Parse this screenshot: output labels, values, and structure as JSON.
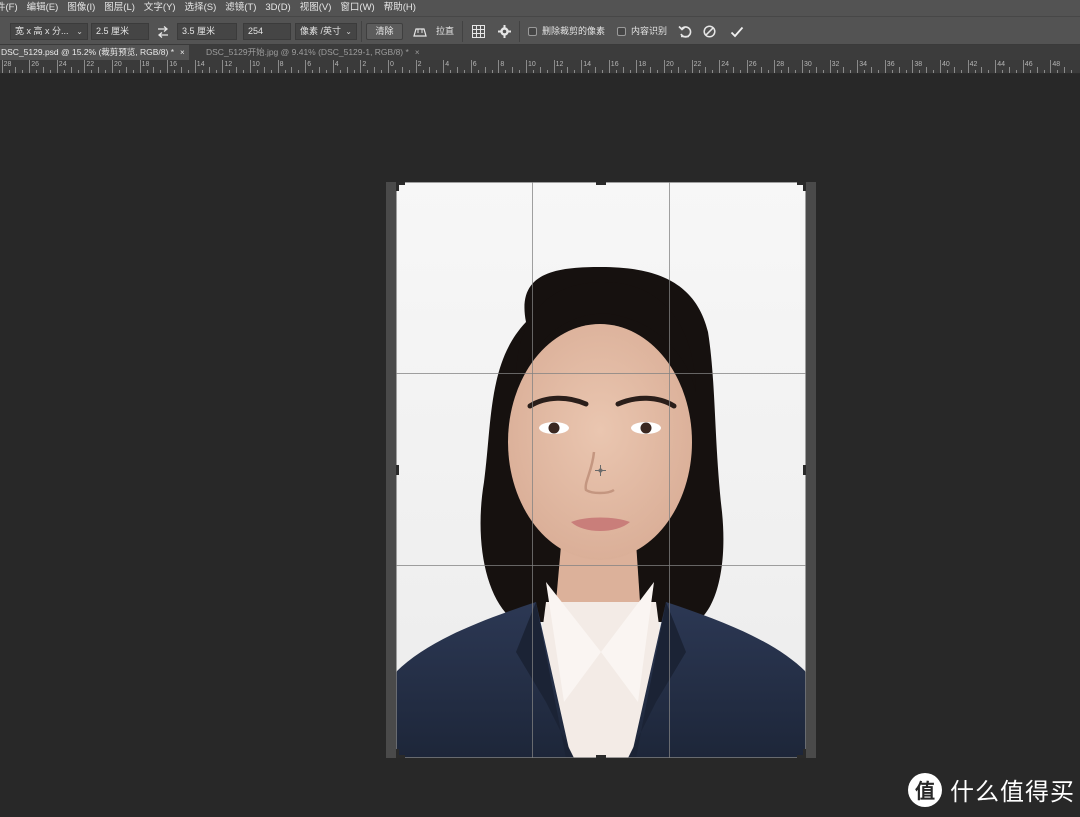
{
  "menu": [
    "件(F)",
    "编辑(E)",
    "图像(I)",
    "图层(L)",
    "文字(Y)",
    "选择(S)",
    "滤镜(T)",
    "3D(D)",
    "视图(V)",
    "窗口(W)",
    "帮助(H)"
  ],
  "options": {
    "ratio_select": "宽 x 高 x 分...",
    "width_value": "2.5 厘米",
    "swap_icon": "swap-arrows-icon",
    "height_value": "3.5 厘米",
    "resolution_value": "254",
    "unit_select": "像素 /英寸",
    "clear_label": "清除",
    "straighten_label": "拉直",
    "delete_cropped_label": "删除裁剪的像素",
    "content_aware_label": "内容识别"
  },
  "tabs": [
    {
      "label": "DSC_5129.psd @ 15.2% (裁剪预览, RGB/8) *",
      "close": "×"
    },
    {
      "label": "DSC_5129开始.jpg @ 9.41% (DSC_5129-1, RGB/8) *",
      "close": "×"
    }
  ],
  "ruler": {
    "labels": [
      "28",
      "26",
      "24",
      "22",
      "20",
      "18",
      "16",
      "14",
      "12",
      "10",
      "8",
      "6",
      "4",
      "2",
      "0",
      "2",
      "4",
      "6",
      "8",
      "10",
      "12",
      "14",
      "16",
      "18",
      "20",
      "22",
      "24",
      "26",
      "28",
      "30",
      "32",
      "34",
      "36",
      "38",
      "40",
      "42",
      "44",
      "46",
      "48"
    ]
  },
  "watermark": {
    "logo": "值",
    "text": "什么值得买"
  },
  "colors": {
    "ui_panel": "#535353",
    "canvas_bg": "#282828",
    "photo_bg": "#f4f4f4",
    "blazer": "#25304a",
    "hair": "#16110f",
    "skin": "#e8c3ac"
  }
}
